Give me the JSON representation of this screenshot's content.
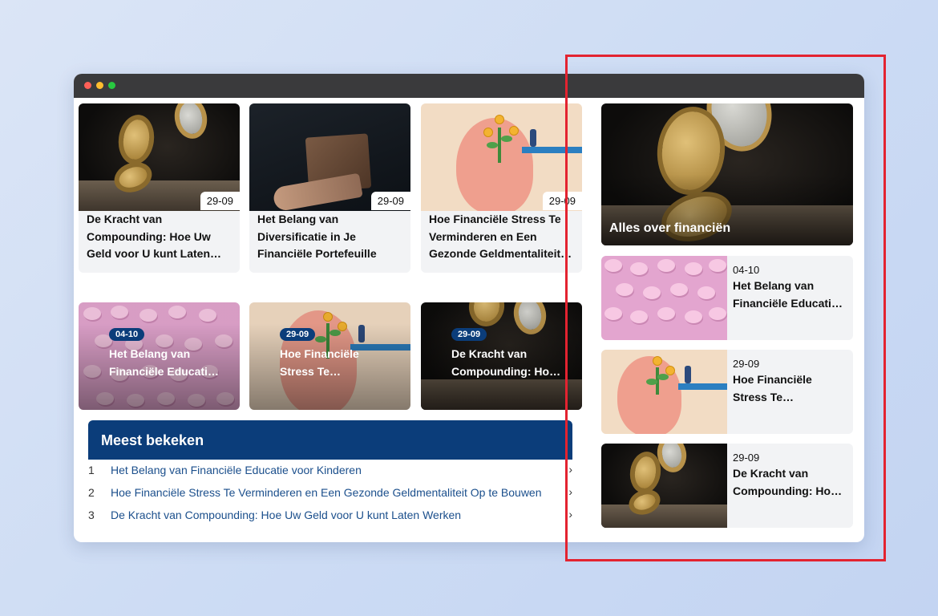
{
  "grid_top": [
    {
      "date": "29-09",
      "title": "De Kracht van Compounding: Hoe Uw Geld voor U kunt Laten Werken"
    },
    {
      "date": "29-09",
      "title": "Het Belang van Diversificatie in Je Financiële Portefeuille"
    },
    {
      "date": "29-09",
      "title": "Hoe Financiële Stress Te Verminderen en Een Gezonde Geldmentaliteit Op te Bouwen"
    }
  ],
  "grid_overlay": [
    {
      "date": "04-10",
      "title": "Het Belang van Financiële Educatie voor Kinderen"
    },
    {
      "date": "29-09",
      "title": "Hoe Financiële Stress Te Verminderen en Een Gezonde Geldmentaliteit Op te Bouwen"
    },
    {
      "date": "29-09",
      "title": "De Kracht van Compounding: Hoe Uw Geld voor U kunt Laten Werken"
    }
  ],
  "most_viewed": {
    "heading": "Meest bekeken",
    "items": [
      {
        "num": "1",
        "title": "Het Belang van Financiële Educatie voor Kinderen",
        "arrow": "›"
      },
      {
        "num": "2",
        "title": "Hoe Financiële Stress Te Verminderen en Een Gezonde Geldmentaliteit Op te Bouwen",
        "arrow": "›"
      },
      {
        "num": "3",
        "title": "De Kracht van Compounding: Hoe Uw Geld voor U kunt Laten Werken",
        "arrow": "›"
      }
    ]
  },
  "sidebar": {
    "feature_title": "Alles over financiën",
    "items": [
      {
        "date": "04-10",
        "title": "Het Belang van Financiële Educatie voor Kinderen"
      },
      {
        "date": "29-09",
        "title": "Hoe Financiële Stress Te Verminderen en Een Gezonde Geldmentaliteit Op te Bouwen"
      },
      {
        "date": "29-09",
        "title": "De Kracht van Compounding: Hoe Uw Geld voor U kunt Laten Werken"
      }
    ]
  },
  "colors": {
    "accent": "#0b3d7a",
    "highlight": "#e32330"
  }
}
